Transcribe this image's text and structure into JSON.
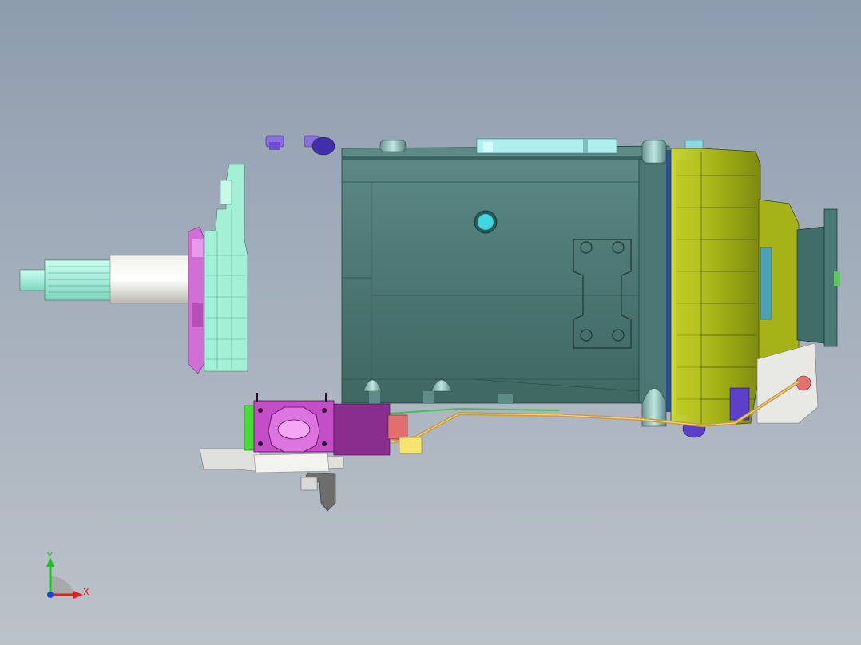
{
  "viewport": {
    "background_top": "#8d9cae",
    "background_bottom": "#bdc2c9"
  },
  "model": {
    "parts": [
      {
        "name": "input-shaft",
        "color": "#a8f0dc"
      },
      {
        "name": "clutch-housing",
        "color": "#a8f0dc"
      },
      {
        "name": "flange-plate",
        "color": "#d86fd8"
      },
      {
        "name": "gearbox-main-housing",
        "color": "#4f7b78"
      },
      {
        "name": "rear-housing",
        "color": "#aebb1e"
      },
      {
        "name": "output-flange",
        "color": "#3f6d69"
      },
      {
        "name": "shift-actuator",
        "color": "#c24fc6"
      },
      {
        "name": "oil-line",
        "color": "#c89a3e"
      },
      {
        "name": "mounting-bracket",
        "color": "#d9d9d9"
      },
      {
        "name": "drain-plug",
        "color": "#3ed6e0"
      },
      {
        "name": "bolts",
        "color": "#5a3fc8"
      }
    ]
  },
  "axis_triad": {
    "x_label": "X",
    "y_label": "Y",
    "x_color": "#e02020",
    "y_color": "#20c020",
    "z_color": "#2040e0"
  }
}
